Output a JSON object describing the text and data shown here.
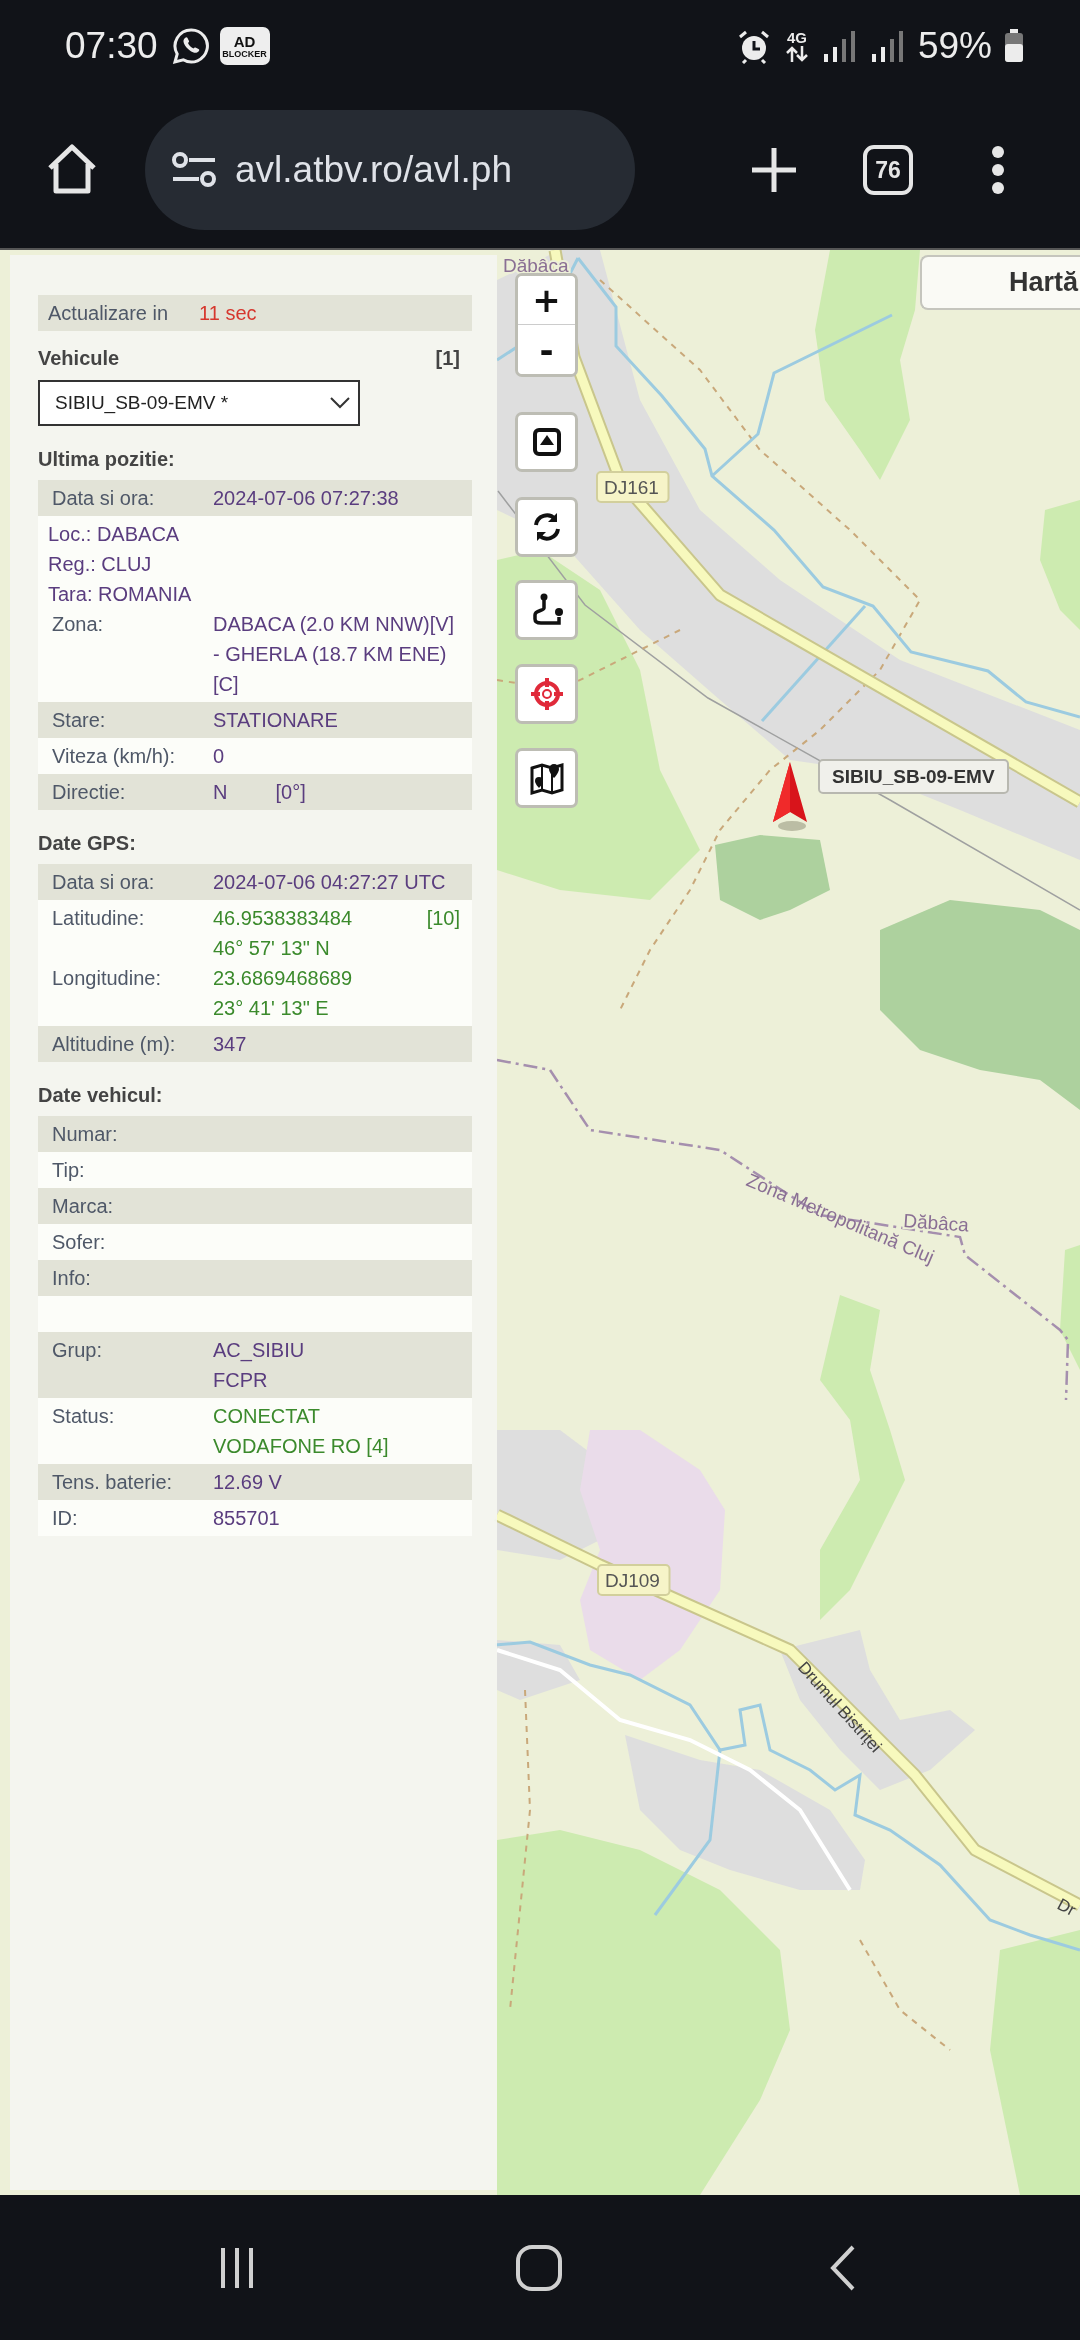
{
  "status_bar": {
    "time": "07:30",
    "badge": {
      "top": "AD",
      "bottom": "BLOCKER"
    },
    "network": "4G",
    "battery": "59%"
  },
  "browser": {
    "url": "avl.atbv.ro/avl.ph",
    "tab_count": "76"
  },
  "panel": {
    "refresh": {
      "label": "Actualizare in",
      "value": "11 sec"
    },
    "vehicles": {
      "title": "Vehicule",
      "count": "[1]",
      "selected": "SIBIU_SB-09-EMV *"
    },
    "sections": [
      {
        "title": "Ultima pozitie:",
        "rows": [
          {
            "kind": "data",
            "items": [
              {
                "kind": "pair",
                "label": "Data si ora:",
                "value": [
                  "2024-07-06 07:27:38"
                ],
                "color": "#5a3d7f"
              }
            ]
          },
          {
            "kind": "data",
            "items": [
              {
                "kind": "line",
                "text": "Loc.: DABACA",
                "color": "#5a3d7f"
              },
              {
                "kind": "line",
                "text": "Reg.: CLUJ",
                "color": "#5a3d7f"
              },
              {
                "kind": "line",
                "text": "Tara: ROMANIA",
                "color": "#5a3d7f"
              },
              {
                "kind": "pair",
                "label": "Zona:",
                "value": [
                  "DABACA (2.0 KM NNW)[V]",
                  "- GHERLA (18.7 KM ENE)",
                  "[C]"
                ],
                "color": "#5a3d7f"
              }
            ]
          },
          {
            "kind": "data",
            "items": [
              {
                "kind": "pair",
                "label": "Stare:",
                "value": [
                  "STATIONARE"
                ],
                "color": "#5a3d7f"
              }
            ]
          },
          {
            "kind": "data",
            "items": [
              {
                "kind": "pair",
                "label": "Viteza (km/h):",
                "value": [
                  "0"
                ],
                "color": "#5a3d7f"
              }
            ]
          },
          {
            "kind": "data",
            "items": [
              {
                "kind": "pair",
                "label": "Directie:",
                "value": [
                  "N"
                ],
                "note": "[0°]",
                "note_right": false,
                "color": "#5a3d7f"
              }
            ]
          }
        ]
      },
      {
        "title": "Date GPS:",
        "rows": [
          {
            "kind": "data",
            "items": [
              {
                "kind": "pair",
                "label": "Data si ora:",
                "value": [
                  "2024-07-06 04:27:27 UTC"
                ],
                "color": "#5a3d7f"
              }
            ]
          },
          {
            "kind": "data",
            "items": [
              {
                "kind": "pair",
                "label": "Latitudine:",
                "value": [
                  "46.9538383484",
                  "46° 57' 13\" N"
                ],
                "note": "[10]",
                "note_right": true,
                "color": "#3b8a2c"
              },
              {
                "kind": "pair",
                "label": "Longitudine:",
                "value": [
                  "23.6869468689",
                  "23° 41' 13\" E"
                ],
                "color": "#3b8a2c"
              }
            ]
          },
          {
            "kind": "data",
            "items": [
              {
                "kind": "pair",
                "label": "Altitudine (m):",
                "value": [
                  "347"
                ],
                "color": "#5a3d7f"
              }
            ]
          }
        ]
      },
      {
        "title": "Date vehicul:",
        "rows": [
          {
            "kind": "data",
            "items": [
              {
                "kind": "pair",
                "label": "Numar:"
              }
            ]
          },
          {
            "kind": "data",
            "items": [
              {
                "kind": "pair",
                "label": "Tip:"
              }
            ]
          },
          {
            "kind": "data",
            "items": [
              {
                "kind": "pair",
                "label": "Marca:"
              }
            ]
          },
          {
            "kind": "data",
            "items": [
              {
                "kind": "pair",
                "label": "Sofer:"
              }
            ]
          },
          {
            "kind": "data",
            "items": [
              {
                "kind": "pair",
                "label": "Info:"
              }
            ]
          },
          {
            "kind": "blank"
          },
          {
            "kind": "data",
            "items": [
              {
                "kind": "pair",
                "label": "Grup:",
                "value": [
                  "AC_SIBIU",
                  "FCPR"
                ],
                "color": "#5a3d7f"
              }
            ]
          },
          {
            "kind": "data",
            "items": [
              {
                "kind": "pair",
                "label": "Status:",
                "value": [
                  "CONECTAT",
                  "VODAFONE RO [4]"
                ],
                "color": "#3b8a2c"
              }
            ]
          },
          {
            "kind": "data",
            "items": [
              {
                "kind": "pair",
                "label": "Tens. baterie:",
                "value": [
                  "12.69 V"
                ],
                "color": "#5a3d7f"
              }
            ]
          },
          {
            "kind": "data",
            "items": [
              {
                "kind": "pair",
                "label": "ID:",
                "value": [
                  "855701"
                ],
                "color": "#5a3d7f"
              }
            ]
          }
        ]
      }
    ]
  },
  "map": {
    "layer_button": "Hartă",
    "zoom": {
      "in": "+",
      "out": "-"
    },
    "marker": {
      "label": "SIBIU_SB-09-EMV"
    },
    "labels": [
      {
        "kind": "place",
        "text": "Dăbâca"
      },
      {
        "kind": "road",
        "text": "DJ161"
      },
      {
        "kind": "boundary",
        "text": "Zona Metropolitană Cluj"
      },
      {
        "kind": "place",
        "text": "Dăbâca"
      },
      {
        "kind": "road",
        "text": "DJ109"
      },
      {
        "kind": "street",
        "text": "Drumul Bistriței"
      },
      {
        "kind": "street",
        "text": "Dr"
      }
    ]
  }
}
